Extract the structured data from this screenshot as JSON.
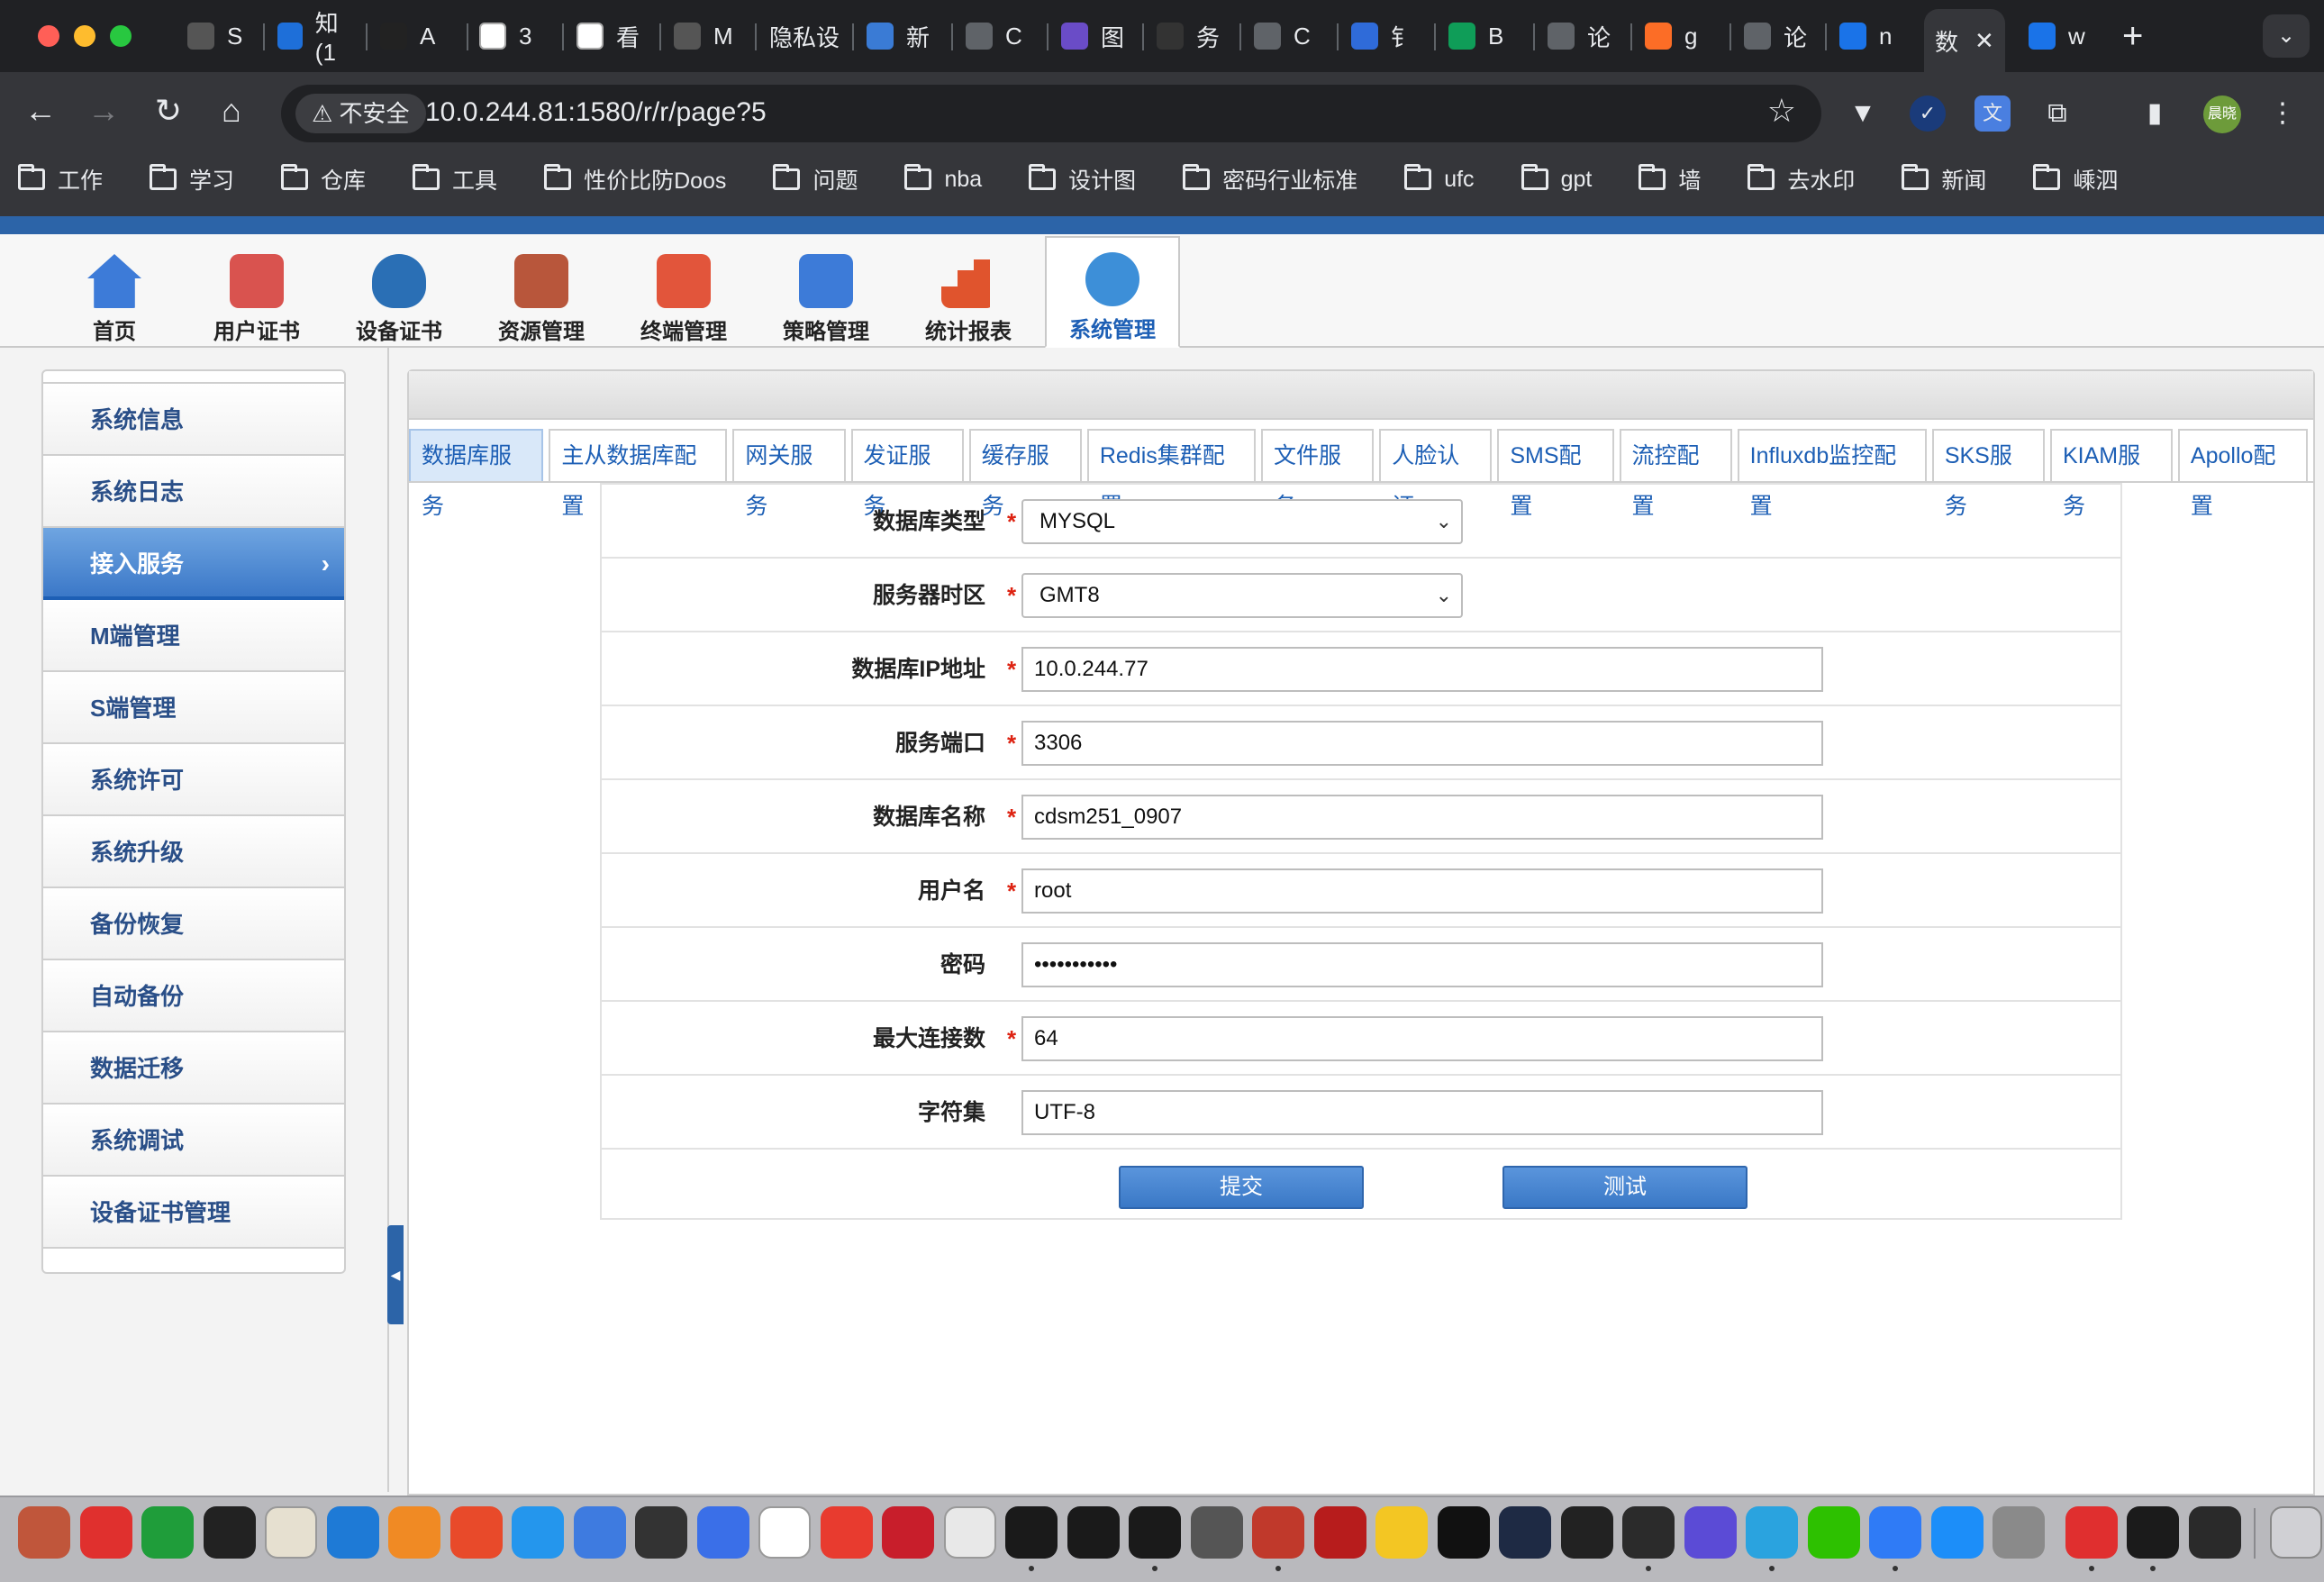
{
  "browser": {
    "tabs": [
      {
        "label": "S",
        "color": "#555555",
        "icon": "generic-site-icon"
      },
      {
        "label": "知 (1",
        "color": "#1e6fd9",
        "icon": "zhihu-icon"
      },
      {
        "label": "A",
        "color": "#222222",
        "icon": "openai-icon"
      },
      {
        "label": "3",
        "color": "#ffffff",
        "icon": "document-icon"
      },
      {
        "label": "看",
        "color": "#ffffff",
        "icon": "document-icon"
      },
      {
        "label": "M",
        "color": "#555555",
        "icon": "generic-site-icon"
      },
      {
        "label": "隐私设",
        "color": "#202124",
        "icon": "none"
      },
      {
        "label": "新",
        "color": "#3a7bd5",
        "icon": "app-icon"
      },
      {
        "label": "C",
        "color": "#5f6368",
        "icon": "globe-icon"
      },
      {
        "label": "图",
        "color": "#6a4cc7",
        "icon": "app-icon"
      },
      {
        "label": "务",
        "color": "#333333",
        "icon": "app-icon"
      },
      {
        "label": "C",
        "color": "#5f6368",
        "icon": "globe-icon"
      },
      {
        "label": "钅",
        "color": "#2f6bd9",
        "icon": "stack-icon"
      },
      {
        "label": "B",
        "color": "#0f9d58",
        "icon": "app-icon"
      },
      {
        "label": "论",
        "color": "#5f6368",
        "icon": "globe-icon"
      },
      {
        "label": "g",
        "color": "#fc6d26",
        "icon": "gitlab-icon"
      },
      {
        "label": "论",
        "color": "#5f6368",
        "icon": "globe-icon"
      },
      {
        "label": "n",
        "color": "#1a73e8",
        "icon": "check-icon"
      },
      {
        "label": "数",
        "color": "#35363a",
        "icon": "none",
        "active": true
      },
      {
        "label": "w",
        "color": "#1a73e8",
        "icon": "search-icon"
      }
    ],
    "insecure_label": "不安全",
    "url": "10.0.244.81:1580/r/r/page?5",
    "profile_label": "晨晓",
    "bookmarks": [
      "工作",
      "学习",
      "仓库",
      "工具",
      "性价比防Doos",
      "问题",
      "nba",
      "设计图",
      "密码行业标准",
      "ufc",
      "gpt",
      "墙",
      "去水印",
      "新闻",
      "嵊泗"
    ]
  },
  "topnav": {
    "items": [
      {
        "label": "首页",
        "icon": "home-icon",
        "color": "#3d7bd8"
      },
      {
        "label": "用户证书",
        "icon": "certificate-icon",
        "color": "#d9534f"
      },
      {
        "label": "设备证书",
        "icon": "medal-icon",
        "color": "#2a6fb5"
      },
      {
        "label": "资源管理",
        "icon": "user-admin-icon",
        "color": "#b8563b"
      },
      {
        "label": "终端管理",
        "icon": "cube-icon",
        "color": "#e2553b"
      },
      {
        "label": "策略管理",
        "icon": "org-chart-icon",
        "color": "#3d7bd8"
      },
      {
        "label": "统计报表",
        "icon": "bar-chart-icon",
        "color": "#e0542d"
      },
      {
        "label": "系统管理",
        "icon": "gear-lock-icon",
        "color": "#3d8fd8"
      }
    ],
    "active_index": 7
  },
  "sidebar": {
    "items": [
      "系统信息",
      "系统日志",
      "接入服务",
      "M端管理",
      "S端管理",
      "系统许可",
      "系统升级",
      "备份恢复",
      "自动备份",
      "数据迁移",
      "系统调试",
      "设备证书管理"
    ],
    "active_index": 2
  },
  "subtabs": {
    "items": [
      "数据库服务",
      "主从数据库配置",
      "网关服务",
      "发证服务",
      "缓存服务",
      "Redis集群配置",
      "文件服务",
      "人脸认证",
      "SMS配置",
      "流控配置",
      "Influxdb监控配置",
      "SKS服务",
      "KIAM服务",
      "Apollo配置"
    ],
    "active_index": 0
  },
  "form": {
    "fields": [
      {
        "label": "数据库类型",
        "required": true,
        "type": "select",
        "value": "MYSQL"
      },
      {
        "label": "服务器时区",
        "required": true,
        "type": "select",
        "value": "GMT8"
      },
      {
        "label": "数据库IP地址",
        "required": true,
        "type": "text",
        "value": "10.0.244.77"
      },
      {
        "label": "服务端口",
        "required": true,
        "type": "text",
        "value": "3306"
      },
      {
        "label": "数据库名称",
        "required": true,
        "type": "text",
        "value": "cdsm251_0907"
      },
      {
        "label": "用户名",
        "required": true,
        "type": "text",
        "value": "root"
      },
      {
        "label": "密码",
        "required": false,
        "type": "password",
        "value": "•••••••••••"
      },
      {
        "label": "最大连接数",
        "required": true,
        "type": "text",
        "value": "64"
      },
      {
        "label": "字符集",
        "required": false,
        "type": "text",
        "value": "UTF-8"
      }
    ],
    "submit_label": "提交",
    "test_label": "测试",
    "required_mark": "*"
  },
  "dock": {
    "apps": [
      {
        "name": "mosaic-app-icon",
        "color": "#c0563b"
      },
      {
        "name": "netease-music-icon",
        "color": "#e0302e"
      },
      {
        "name": "music-app-icon",
        "color": "#1f9d3a"
      },
      {
        "name": "panda-app-icon",
        "color": "#222222"
      },
      {
        "name": "coffee-app-icon",
        "color": "#e6e0d0"
      },
      {
        "name": "shark-app-icon",
        "color": "#1e7ad6"
      },
      {
        "name": "triangle-app-icon",
        "color": "#f08a24"
      },
      {
        "name": "arrow-app-icon",
        "color": "#e84a2a"
      },
      {
        "name": "docker-icon",
        "color": "#2496ed"
      },
      {
        "name": "cat-app-icon",
        "color": "#3e7be0"
      },
      {
        "name": "goat-app-icon",
        "color": "#333333"
      },
      {
        "name": "pen-app-icon",
        "color": "#3a6fe8"
      },
      {
        "name": "typora-icon",
        "color": "#ffffff"
      },
      {
        "name": "mail-app-icon",
        "color": "#e83b2f"
      },
      {
        "name": "parallels-icon",
        "color": "#c81e2b"
      },
      {
        "name": "chrome-icon",
        "color": "#e8e8e8"
      },
      {
        "name": "intellij-icon",
        "color": "#1a1a1a"
      },
      {
        "name": "intellij-alt-icon",
        "color": "#1a1a1a"
      },
      {
        "name": "datagrip-icon",
        "color": "#1a1a1a"
      },
      {
        "name": "tunnel-app-icon",
        "color": "#555555"
      },
      {
        "name": "star-app-icon",
        "color": "#c0392b"
      },
      {
        "name": "filezilla-icon",
        "color": "#b71c1c"
      },
      {
        "name": "colors-app-icon",
        "color": "#f3c623"
      },
      {
        "name": "terminal-icon",
        "color": "#111111"
      },
      {
        "name": "prompt-app-icon",
        "color": "#1e2a44"
      },
      {
        "name": "paper-plane-app-icon",
        "color": "#222222"
      },
      {
        "name": "flask-app-icon",
        "color": "#2b2b2b"
      },
      {
        "name": "d-app-icon",
        "color": "#5b4bd6"
      },
      {
        "name": "telegram-icon",
        "color": "#2aa3df"
      },
      {
        "name": "wechat-icon",
        "color": "#2dc100"
      },
      {
        "name": "feishu-icon",
        "color": "#2f7bf6"
      },
      {
        "name": "app-store-icon",
        "color": "#1c8ef9"
      },
      {
        "name": "settings-icon",
        "color": "#8a8a8a"
      },
      {
        "name": "wps-icon",
        "color": "#e02f2f"
      },
      {
        "name": "activity-monitor-icon",
        "color": "#1b1b1b"
      },
      {
        "name": "console-icon",
        "color": "#2a2a2a"
      }
    ],
    "trash": "trash-icon"
  }
}
